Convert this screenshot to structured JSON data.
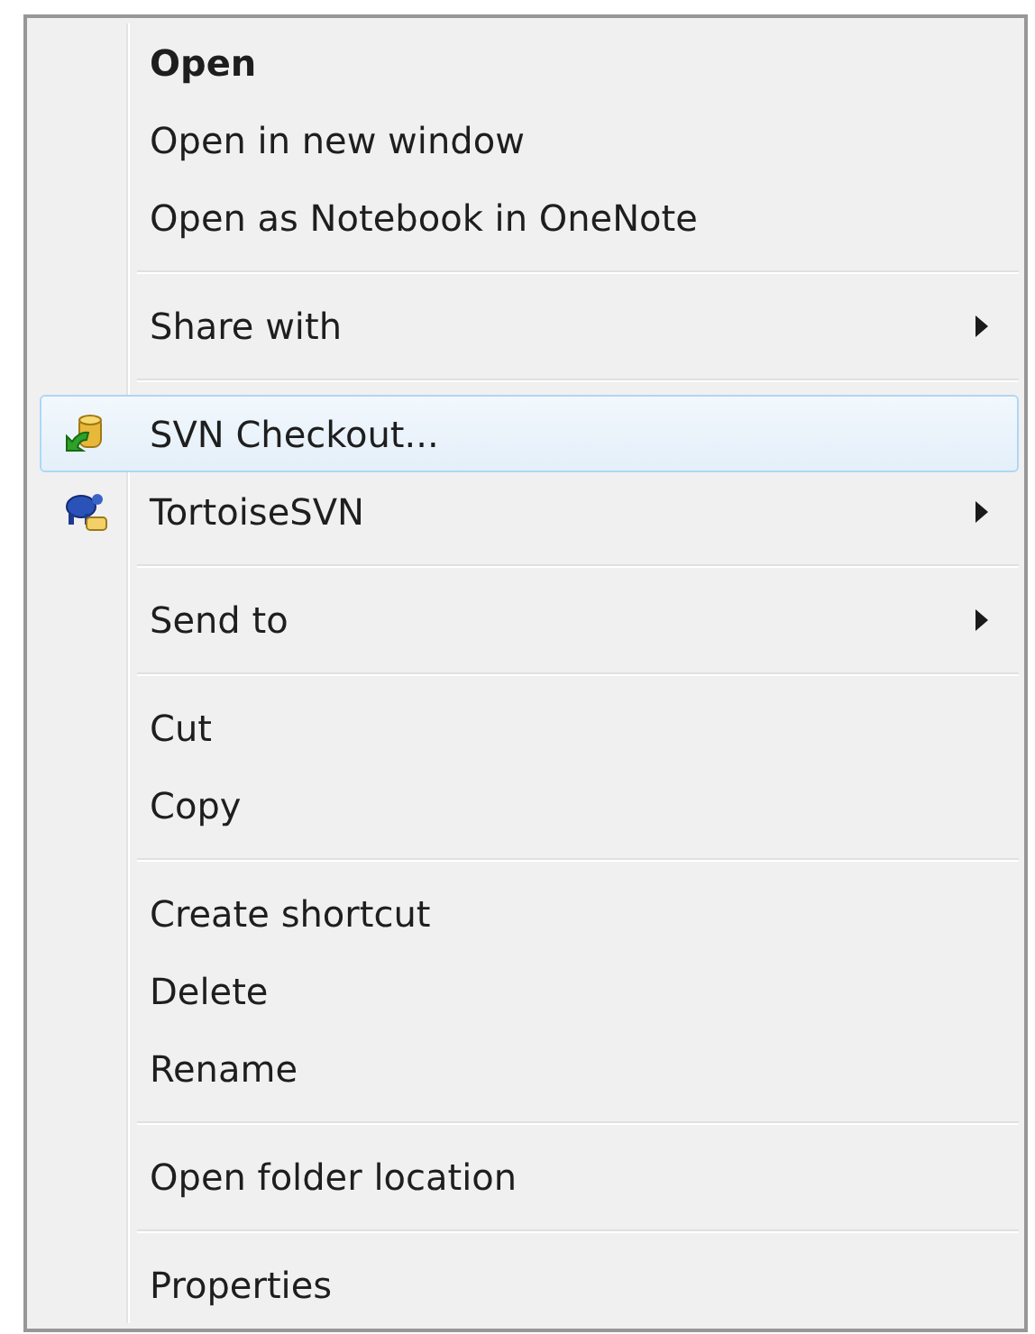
{
  "menu": {
    "entries": [
      {
        "kind": "item",
        "label": "Open",
        "bold": true,
        "submenu": false,
        "selected": false
      },
      {
        "kind": "item",
        "label": "Open in new window",
        "bold": false,
        "submenu": false,
        "selected": false
      },
      {
        "kind": "item",
        "label": "Open as Notebook in OneNote",
        "bold": false,
        "submenu": false,
        "selected": false
      },
      {
        "kind": "separator"
      },
      {
        "kind": "item",
        "label": "Share with",
        "bold": false,
        "submenu": true,
        "selected": false
      },
      {
        "kind": "separator"
      },
      {
        "kind": "icon_item",
        "label": "SVN Checkout...",
        "bold": false,
        "submenu": false,
        "selected": true
      },
      {
        "kind": "icon_item",
        "label": "TortoiseSVN",
        "bold": false,
        "submenu": true,
        "selected": false
      },
      {
        "kind": "separator"
      },
      {
        "kind": "item",
        "label": "Send to",
        "bold": false,
        "submenu": true,
        "selected": false
      },
      {
        "kind": "separator"
      },
      {
        "kind": "item",
        "label": "Cut",
        "bold": false,
        "submenu": false,
        "selected": false
      },
      {
        "kind": "item",
        "label": "Copy",
        "bold": false,
        "submenu": false,
        "selected": false
      },
      {
        "kind": "separator"
      },
      {
        "kind": "item",
        "label": "Create shortcut",
        "bold": false,
        "submenu": false,
        "selected": false
      },
      {
        "kind": "item",
        "label": "Delete",
        "bold": false,
        "submenu": false,
        "selected": false
      },
      {
        "kind": "item",
        "label": "Rename",
        "bold": false,
        "submenu": false,
        "selected": false
      },
      {
        "kind": "separator"
      },
      {
        "kind": "item",
        "label": "Open folder location",
        "bold": false,
        "submenu": false,
        "selected": false
      },
      {
        "kind": "separator"
      },
      {
        "kind": "item",
        "label": "Properties",
        "bold": false,
        "submenu": false,
        "selected": false
      }
    ]
  }
}
